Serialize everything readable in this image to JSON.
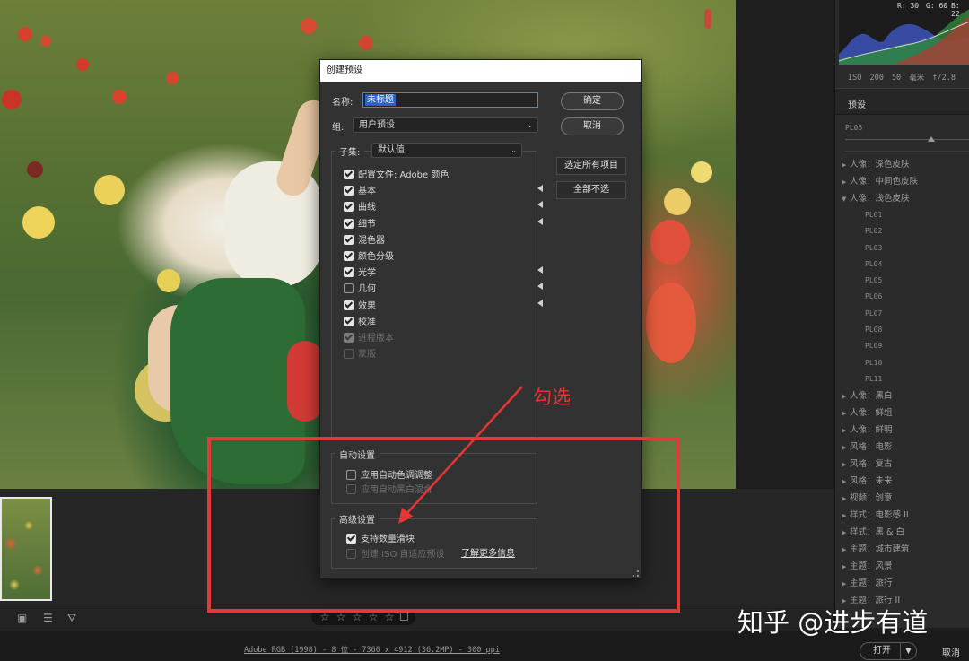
{
  "histogram": {
    "r": "R: 30",
    "g": "G: 60",
    "b": "B: 22"
  },
  "exif": "ISO 200   50 毫米   f/2.8",
  "presets_panel": {
    "title": "预设",
    "amount_label": "PL05",
    "items": [
      {
        "label": "人像：深色皮肤",
        "expanded": false
      },
      {
        "label": "人像：中间色皮肤",
        "expanded": false
      },
      {
        "label": "人像：浅色皮肤",
        "expanded": true
      }
    ],
    "sub_items": [
      "PL01",
      "PL02",
      "PL03",
      "PL04",
      "PL05",
      "PL06",
      "PL07",
      "PL08",
      "PL09",
      "PL10",
      "PL11"
    ],
    "more_items": [
      "人像：黑白",
      "人像：鲜组",
      "人像：鲜明",
      "风格：电影",
      "风格：复古",
      "风格：未来",
      "视频：创意",
      "样式：电影感 II",
      "样式：黑 & 白",
      "主题：城市建筑",
      "主题：风景",
      "主题：旅行",
      "主题：旅行 II"
    ]
  },
  "dialog": {
    "title": "创建预设",
    "name_label": "名称:",
    "name_value": "未标题",
    "group_label": "组:",
    "group_value": "用户预设",
    "ok_button": "确定",
    "cancel_button": "取消",
    "subset_label": "子集:",
    "subset_value": "默认值",
    "select_all_button": "选定所有项目",
    "select_none_button": "全部不选",
    "settings": [
      {
        "label": "配置文件: Adobe 颜色",
        "checked": true,
        "arrow": false,
        "disabled": false
      },
      {
        "label": "基本",
        "checked": true,
        "arrow": true,
        "disabled": false
      },
      {
        "label": "曲线",
        "checked": true,
        "arrow": true,
        "disabled": false
      },
      {
        "label": "细节",
        "checked": true,
        "arrow": true,
        "disabled": false
      },
      {
        "label": "混色器",
        "checked": true,
        "arrow": false,
        "disabled": false
      },
      {
        "label": "颜色分级",
        "checked": true,
        "arrow": false,
        "disabled": false
      },
      {
        "label": "光学",
        "checked": true,
        "arrow": true,
        "disabled": false
      },
      {
        "label": "几何",
        "checked": false,
        "arrow": true,
        "disabled": false
      },
      {
        "label": "效果",
        "checked": true,
        "arrow": true,
        "disabled": false
      },
      {
        "label": "校准",
        "checked": true,
        "arrow": false,
        "disabled": false
      },
      {
        "label": "进程版本",
        "checked": true,
        "arrow": false,
        "disabled": true
      },
      {
        "label": "蒙版",
        "checked": false,
        "arrow": false,
        "disabled": true
      }
    ],
    "auto_title": "自动设置",
    "auto_tone": "应用自动色调调整",
    "auto_bw": "应用自动黑白混合",
    "adv_title": "高级设置",
    "support_amount": "支持数量滑块",
    "create_iso": "创建 ISO 自适应预设",
    "learn_more": "了解更多信息"
  },
  "annotation": {
    "text": "勾选",
    "color": "#e53535"
  },
  "bottom": {
    "doc_info": "Adobe RGB (1998) - 8 位 - 7360 x 4912 (36.2MP) - 300 ppi",
    "open_button": "打开",
    "cancel_button": "取消"
  },
  "watermark": "知乎 @进步有道",
  "rating_stars": 5
}
